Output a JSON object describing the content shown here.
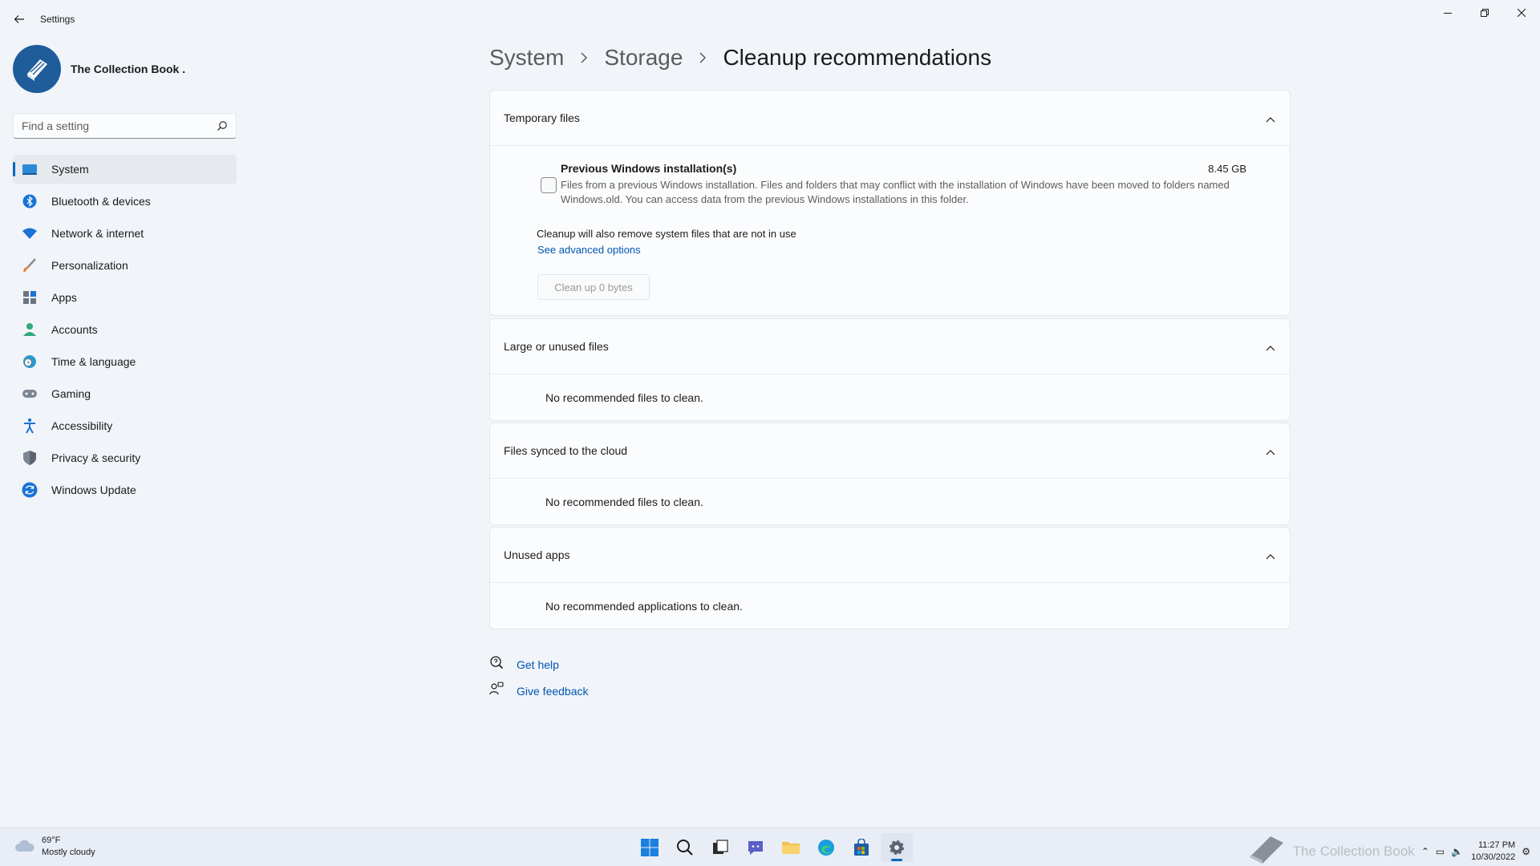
{
  "window": {
    "title": "Settings",
    "minimize_icon": "minimize-icon",
    "maximize_icon": "restore-icon",
    "close_icon": "close-icon"
  },
  "profile": {
    "name": "The Collection Book ."
  },
  "search": {
    "placeholder": "Find a setting"
  },
  "sidebar": {
    "items": [
      {
        "label": "System",
        "icon": "system-icon",
        "active": true
      },
      {
        "label": "Bluetooth & devices",
        "icon": "bluetooth-icon"
      },
      {
        "label": "Network & internet",
        "icon": "wifi-icon"
      },
      {
        "label": "Personalization",
        "icon": "brush-icon"
      },
      {
        "label": "Apps",
        "icon": "apps-icon"
      },
      {
        "label": "Accounts",
        "icon": "account-icon"
      },
      {
        "label": "Time & language",
        "icon": "globe-clock-icon"
      },
      {
        "label": "Gaming",
        "icon": "controller-icon"
      },
      {
        "label": "Accessibility",
        "icon": "accessibility-icon"
      },
      {
        "label": "Privacy & security",
        "icon": "shield-icon"
      },
      {
        "label": "Windows Update",
        "icon": "update-icon"
      }
    ]
  },
  "breadcrumb": {
    "items": [
      "System",
      "Storage",
      "Cleanup recommendations"
    ]
  },
  "sections": {
    "temporary": {
      "title": "Temporary files",
      "item_title": "Previous Windows installation(s)",
      "item_size": "8.45 GB",
      "item_desc": "Files from a previous Windows installation.  Files and folders that may conflict with the installation of Windows have been moved to folders named Windows.old.  You can access data from the previous Windows installations in this folder.",
      "note": "Cleanup will also remove system files that are not in use",
      "advanced_link": "See advanced options",
      "cleanup_button": "Clean up 0 bytes"
    },
    "large": {
      "title": "Large or unused files",
      "empty": "No recommended files to clean."
    },
    "cloud": {
      "title": "Files synced to the cloud",
      "empty": "No recommended files to clean."
    },
    "apps": {
      "title": "Unused apps",
      "empty": "No recommended applications to clean."
    }
  },
  "help": {
    "get_help": "Get help",
    "give_feedback": "Give feedback"
  },
  "taskbar": {
    "weather_temp": "69°F",
    "weather_desc": "Mostly cloudy",
    "watermark": "The Collection Book",
    "time": "11:27 PM",
    "date": "10/30/2022",
    "accent": "#0067c0"
  }
}
